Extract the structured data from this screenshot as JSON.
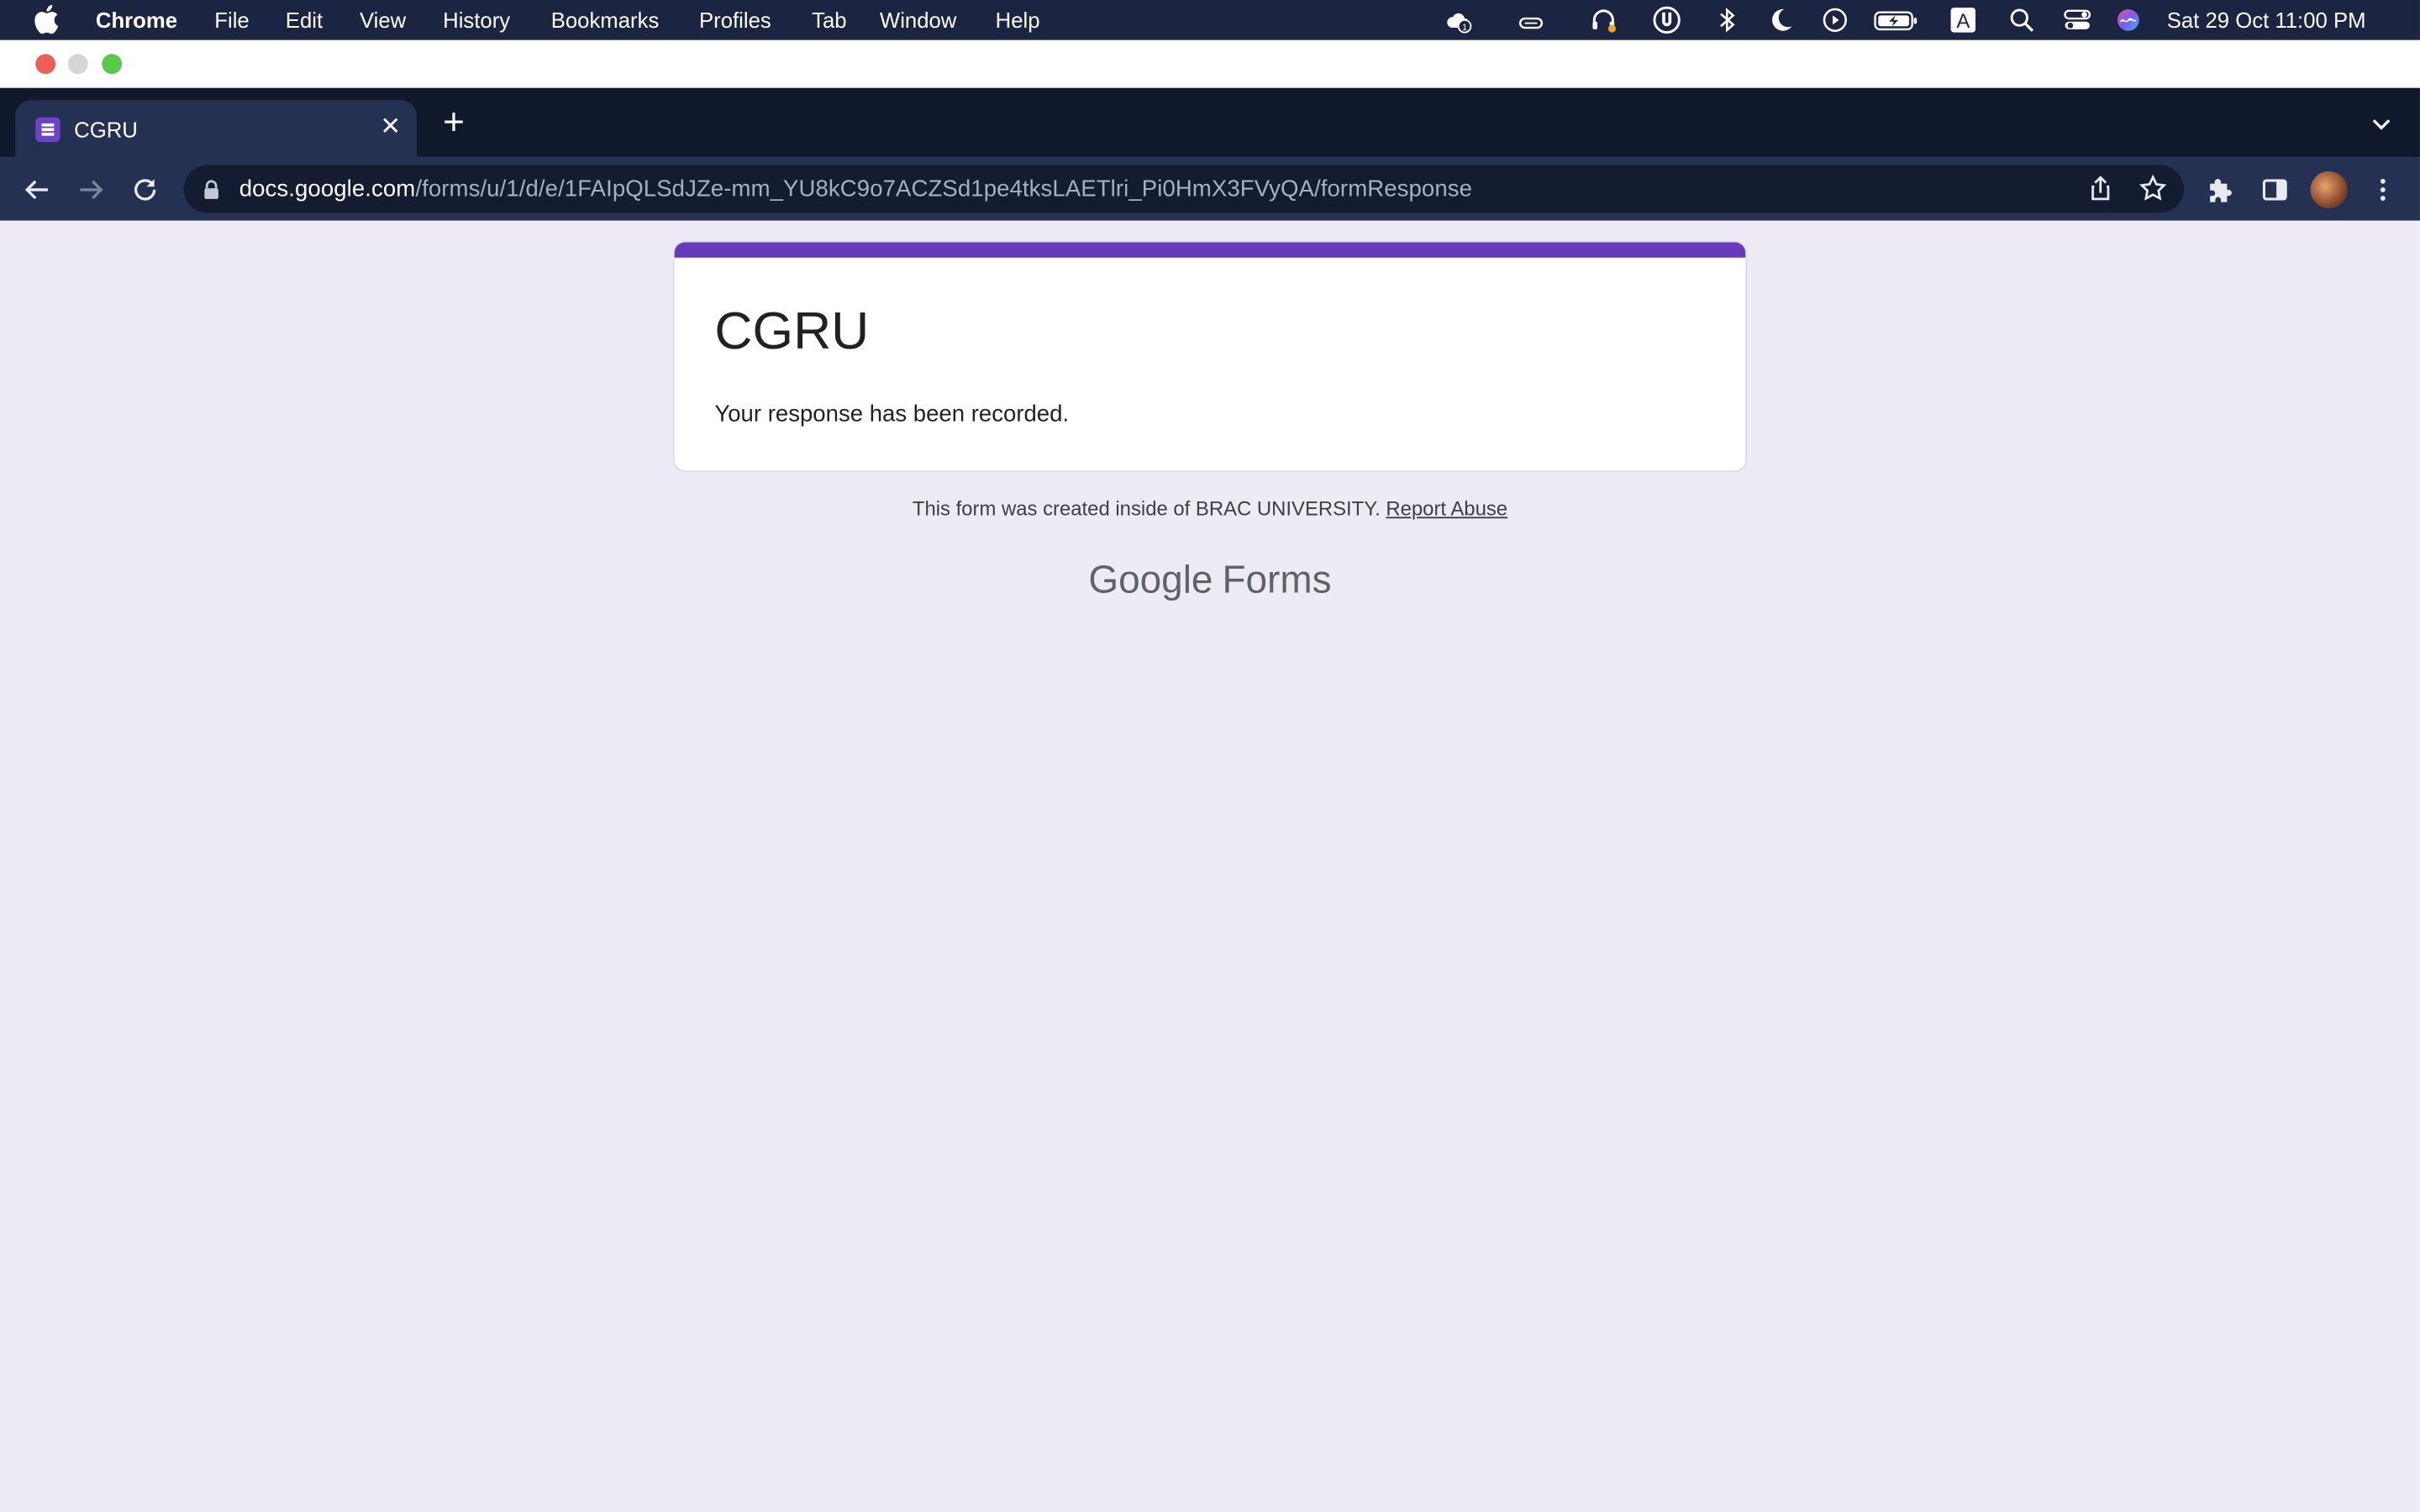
{
  "menubar": {
    "app": "Chrome",
    "items": [
      "File",
      "Edit",
      "View",
      "History",
      "Bookmarks",
      "Profiles",
      "Tab",
      "Window",
      "Help"
    ],
    "clock": "Sat 29 Oct  11:00 PM",
    "status_icons": [
      "cloud-notification-icon",
      "creative-cloud-icon",
      "headset-icon",
      "torrent-icon",
      "bluetooth-icon",
      "moon-icon",
      "play-icon",
      "battery-icon",
      "input-source-icon",
      "spotlight-icon",
      "control-center-icon",
      "siri-icon"
    ]
  },
  "tab": {
    "title": "CGRU"
  },
  "omnibox": {
    "host": "docs.google.com",
    "path": "/forms/u/1/d/e/1FAIpQLSdJZe-mm_YU8kC9o7ACZSd1pe4tksLAETlri_Pi0HmX3FVyQA/formResponse"
  },
  "form": {
    "title": "CGRU",
    "message": "Your response has been recorded."
  },
  "footer": {
    "text": "This form was created inside of BRAC UNIVERSITY.",
    "report_link": "Report Abuse"
  },
  "brand": {
    "google": "Google",
    "forms": "Forms"
  },
  "colors": {
    "accent": "#673ab7",
    "page_bg": "#efebf6",
    "menubar_bg": "#1b2440",
    "toolbar_bg": "#243153"
  }
}
